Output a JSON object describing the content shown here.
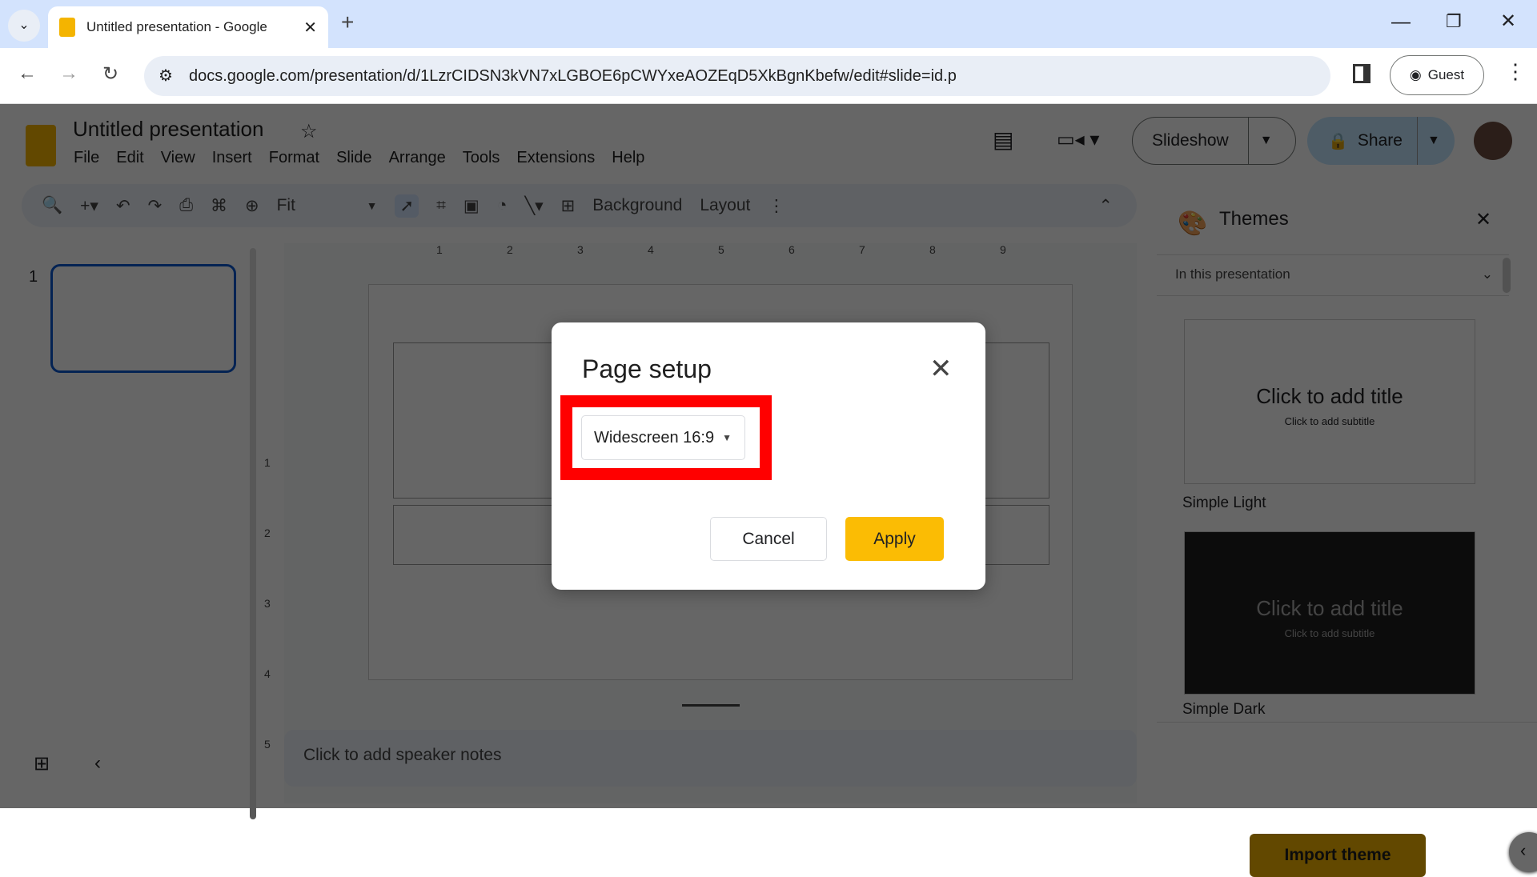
{
  "browser": {
    "tab_title": "Untitled presentation - Google",
    "url": "docs.google.com/presentation/d/1LzrCIDSN3kVN7xLGBOE6pCWYxeAOZEqD5XkBgnKbefw/edit#slide=id.p",
    "profile": "Guest"
  },
  "app": {
    "title": "Untitled presentation",
    "menu": [
      "File",
      "Edit",
      "View",
      "Insert",
      "Format",
      "Slide",
      "Arrange",
      "Tools",
      "Extensions",
      "Help"
    ],
    "slideshow": "Slideshow",
    "share": "Share"
  },
  "toolbar": {
    "zoom": "Fit",
    "background": "Background",
    "layout": "Layout"
  },
  "filmstrip": {
    "slide_number": "1"
  },
  "ruler": {
    "h": [
      "1",
      "2",
      "3",
      "4",
      "5",
      "6",
      "7",
      "8",
      "9"
    ],
    "v": [
      "1",
      "2",
      "3",
      "4",
      "5"
    ]
  },
  "notes": {
    "placeholder": "Click to add speaker notes"
  },
  "themes": {
    "title": "Themes",
    "filter": "In this presentation",
    "items": [
      {
        "name": "Simple Light",
        "title": "Click to add title",
        "subtitle": "Click to add subtitle"
      },
      {
        "name": "Simple Dark",
        "title": "Click to add title",
        "subtitle": "Click to add subtitle"
      }
    ],
    "import": "Import theme"
  },
  "dialog": {
    "title": "Page setup",
    "selected": "Widescreen 16:9",
    "cancel": "Cancel",
    "apply": "Apply"
  },
  "colors": {
    "accent": "#fbbc04",
    "highlight": "#ff0000",
    "selection": "#0b57d0"
  }
}
